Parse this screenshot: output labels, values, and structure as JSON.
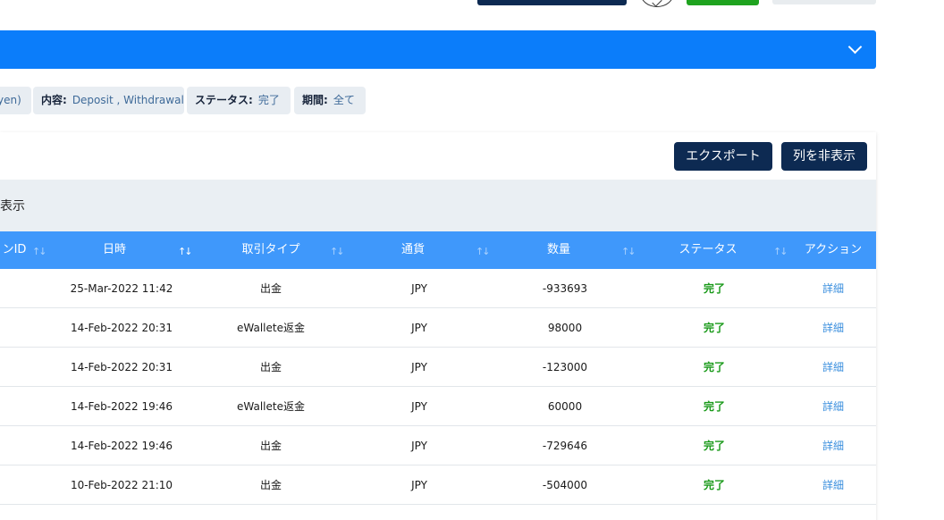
{
  "filters": [
    {
      "key": "",
      "value": "yen)"
    },
    {
      "key": "内容:",
      "value": "Deposit , Withdrawal"
    },
    {
      "key": "ステータス:",
      "value": "完了"
    },
    {
      "key": "期間:",
      "value": "全て"
    }
  ],
  "toolbar": {
    "export_label": "エクスポート",
    "hide_columns_label": "列を非表示"
  },
  "subbar": {
    "text": "表示"
  },
  "table": {
    "headers": [
      "ンID",
      "日時",
      "取引タイプ",
      "通貨",
      "数量",
      "ステータス",
      "アクション"
    ],
    "rows": [
      {
        "date": "25-Mar-2022 11:42",
        "type": "出金",
        "currency": "JPY",
        "amount": "-933693",
        "status": "完了",
        "action": "詳細"
      },
      {
        "date": "14-Feb-2022 20:31",
        "type": "eWallete返金",
        "currency": "JPY",
        "amount": "98000",
        "status": "完了",
        "action": "詳細"
      },
      {
        "date": "14-Feb-2022 20:31",
        "type": "出金",
        "currency": "JPY",
        "amount": "-123000",
        "status": "完了",
        "action": "詳細"
      },
      {
        "date": "14-Feb-2022 19:46",
        "type": "eWallete返金",
        "currency": "JPY",
        "amount": "60000",
        "status": "完了",
        "action": "詳細"
      },
      {
        "date": "14-Feb-2022 19:46",
        "type": "出金",
        "currency": "JPY",
        "amount": "-729646",
        "status": "完了",
        "action": "詳細"
      },
      {
        "date": "10-Feb-2022 21:10",
        "type": "出金",
        "currency": "JPY",
        "amount": "-504000",
        "status": "完了",
        "action": "詳細"
      }
    ]
  },
  "colors": {
    "navy": "#0d2a52",
    "primary_blue": "#0b7dfa",
    "header_blue": "#3f98fb",
    "status_green": "#1a9a1a",
    "link_blue": "#3b8fde"
  }
}
